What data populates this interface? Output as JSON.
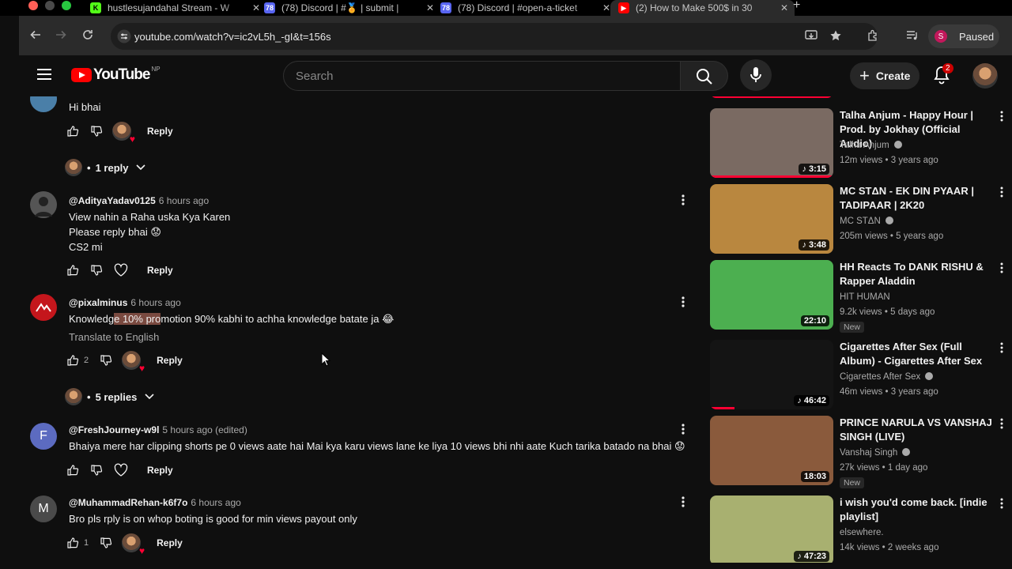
{
  "browser": {
    "tabs": [
      {
        "title": "hustlesujandahal Stream - W",
        "favicon": "K",
        "favicon_color": "#53fc18",
        "favicon_text_color": "#000"
      },
      {
        "title": "(78) Discord | #🏅 | submit |",
        "favicon": "78",
        "favicon_color": "#5865f2",
        "favicon_text_color": "#fff"
      },
      {
        "title": "(78) Discord | #open-a-ticket",
        "favicon": "78",
        "favicon_color": "#5865f2",
        "favicon_text_color": "#fff"
      },
      {
        "title": "(2) How to Make 500$ in 30",
        "favicon": "▶",
        "favicon_color": "#ff0000",
        "favicon_text_color": "#fff"
      }
    ],
    "url": "youtube.com/watch?v=ic2vL5h_-gI&t=156s",
    "profile_initial": "S",
    "profile_label": "Paused"
  },
  "youtube": {
    "logo_text": "YouTube",
    "country_code": "NP",
    "search_placeholder": "Search",
    "create_label": "Create",
    "notification_count": "2"
  },
  "comments": {
    "top_partial": {
      "text": "Hi bhai",
      "reply_label": "Reply",
      "replies_label": "1 reply"
    },
    "items": [
      {
        "author": "@AdityaYadav0125",
        "time": "6 hours ago",
        "lines": [
          "View nahin a Raha uska Kya Karen",
          "Please reply bhai 😟",
          "CS2 mi"
        ],
        "likes": "",
        "reply_label": "Reply",
        "avatar_color": "#555",
        "avatar_letter": ""
      },
      {
        "author": "@pixalminus",
        "time": "6 hours ago",
        "text_before": "Knowledg",
        "text_highlight": "e 10% pro",
        "text_after": "motion 90% kabhi to achha knowledge batate ja 😂",
        "translate_label": "Translate to English",
        "likes": "2",
        "reply_label": "Reply",
        "replies_label": "5 replies",
        "avatar_color": "#c4161c",
        "avatar_letter": ""
      },
      {
        "author": "@FreshJourney-w9l",
        "time": "5 hours ago (edited)",
        "text": "Bhaiya mere har clipping shorts pe 0 views aate hai Mai kya karu views lane ke liya 10 views bhi nhi aate Kuch tarika batado na bhai 😟",
        "reply_label": "Reply",
        "avatar_color": "#5c6bc0",
        "avatar_letter": "F"
      },
      {
        "author": "@MuhammadRehan-k6f7o",
        "time": "6 hours ago",
        "text": "Bro pls rply is on whop boting  is good for min views payout only",
        "likes": "1",
        "reply_label": "Reply",
        "avatar_color": "#4a4a4a",
        "avatar_letter": "M"
      }
    ]
  },
  "sidebar": {
    "videos": [
      {
        "title": "Talha Anjum - Happy Hour | Prod. by Jokhay (Official Audio)",
        "channel": "Talha Anjum",
        "verified": true,
        "meta": "12m views • 3 years ago",
        "duration": "3:15",
        "music": true,
        "badge": "",
        "progress": 1.0,
        "thumb": "#7a6a62"
      },
      {
        "title": "MC STΔN - EK DIN PYAAR | TADIPAAR | 2K20",
        "channel": "MC STΔN",
        "verified": true,
        "meta": "205m views • 5 years ago",
        "duration": "3:48",
        "music": true,
        "badge": "",
        "progress": 0,
        "thumb": "#b9873f"
      },
      {
        "title": "HH Reacts To DANK RISHU & Rapper Aladdin",
        "channel": "HIT HUMAN",
        "verified": false,
        "meta": "9.2k views • 5 days ago",
        "duration": "22:10",
        "music": false,
        "badge": "New",
        "progress": 0,
        "thumb": "#4caf50"
      },
      {
        "title": "Cigarettes After Sex (Full Album) - Cigarettes After Sex",
        "channel": "Cigarettes After Sex",
        "verified": true,
        "meta": "46m views • 3 years ago",
        "duration": "46:42",
        "music": true,
        "badge": "",
        "progress": 0.2,
        "thumb": "#141414"
      },
      {
        "title": "PRINCE NARULA VS VANSHAJ SINGH (LIVE)",
        "channel": "Vanshaj Singh",
        "verified": true,
        "meta": "27k views • 1 day ago",
        "duration": "18:03",
        "music": false,
        "badge": "New",
        "progress": 0,
        "thumb": "#8a5a3c"
      },
      {
        "title": "i wish you'd come back. [indie playlist]",
        "channel": "elsewhere.",
        "verified": false,
        "meta": "14k views • 2 weeks ago",
        "duration": "47:23",
        "music": true,
        "badge": "",
        "progress": 0,
        "thumb": "#a8b070"
      }
    ]
  }
}
